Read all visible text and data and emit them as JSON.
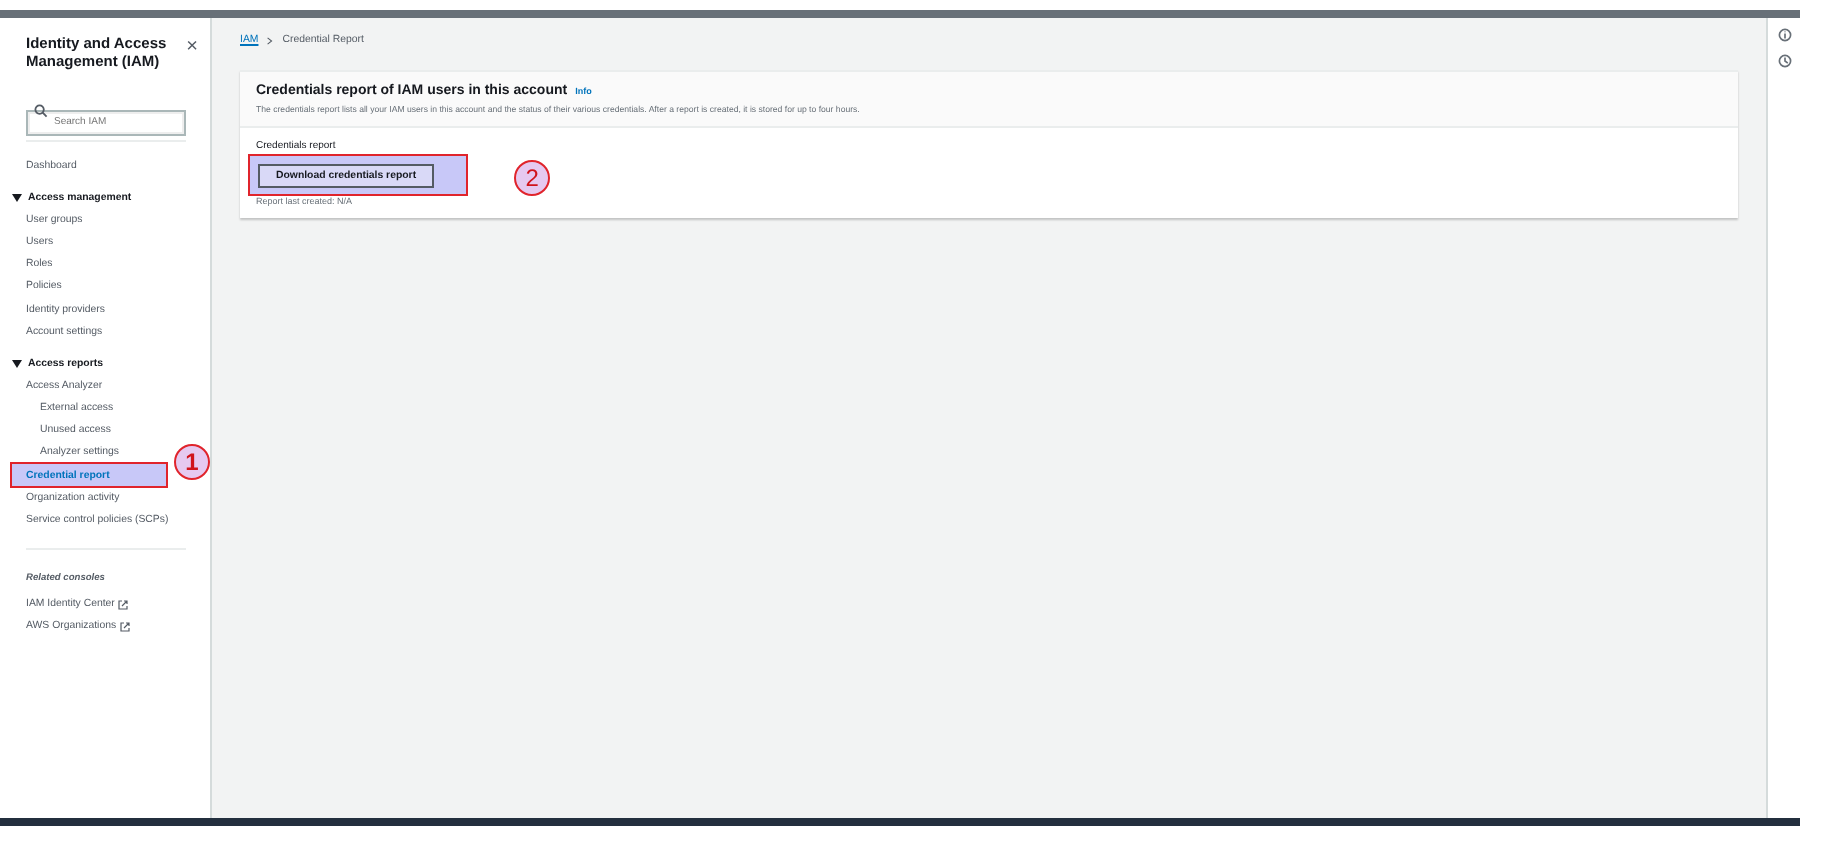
{
  "sidebar": {
    "title": "Identity and Access Management (IAM)",
    "close": "×",
    "search": {
      "placeholder": "Search IAM"
    },
    "items": [
      {
        "label": "Dashboard",
        "kind": "link",
        "selected": false
      },
      {
        "label": "Access management",
        "kind": "section",
        "expanded": true,
        "children": [
          {
            "label": "User groups",
            "selected": false
          },
          {
            "label": "Users",
            "selected": false
          },
          {
            "label": "Roles",
            "selected": false
          },
          {
            "label": "Policies",
            "selected": false
          },
          {
            "label": "Identity providers",
            "selected": false
          },
          {
            "label": "Account settings",
            "selected": false
          }
        ]
      },
      {
        "label": "Access reports",
        "kind": "section",
        "expanded": true,
        "children": [
          {
            "label": "Access Analyzer",
            "selected": false,
            "children": [
              {
                "label": "External access",
                "selected": false
              },
              {
                "label": "Unused access",
                "selected": false
              },
              {
                "label": "Analyzer settings",
                "selected": false
              }
            ]
          },
          {
            "label": "Credential report",
            "selected": true,
            "callout": "1"
          },
          {
            "label": "Organization activity",
            "selected": false
          },
          {
            "label": "Service control policies (SCPs)",
            "selected": false
          }
        ]
      }
    ],
    "related": {
      "heading": "Related consoles",
      "links": [
        "IAM Identity Center",
        "AWS Organizations"
      ]
    }
  },
  "breadcrumb": [
    "IAM",
    "Credential Report"
  ],
  "panel": {
    "title": "Credentials report of IAM users in this account",
    "info": "Info",
    "description": "The credentials report lists all your IAM users in this account and the status of their various credentials. After a report is created, it is stored for up to four hours.",
    "field_label": "Credentials report",
    "button": "Download credentials report",
    "button_callout": "2",
    "note": "Report last created: N/A"
  }
}
